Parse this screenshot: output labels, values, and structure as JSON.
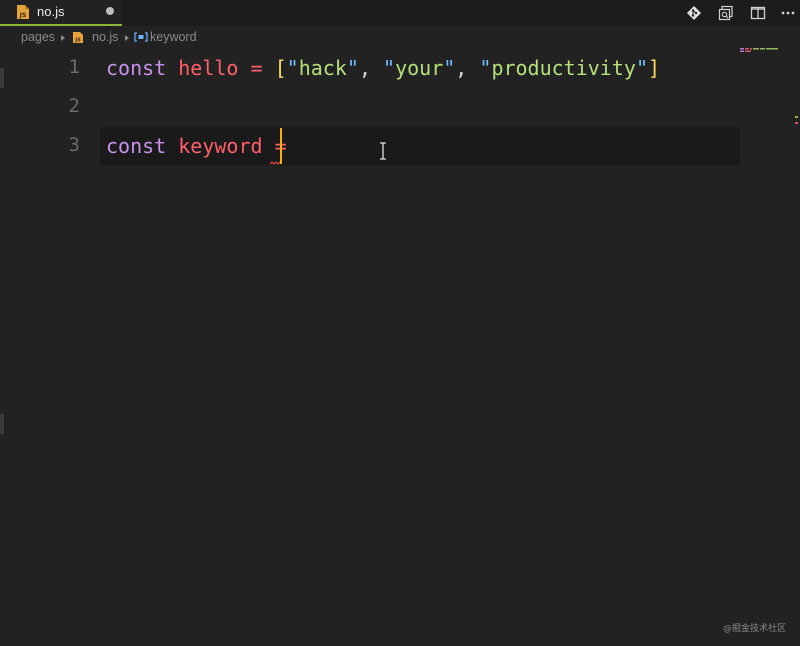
{
  "tab": {
    "filename": "no.js",
    "icon": "js-file-icon",
    "modified": true,
    "accent": "#8bb63a"
  },
  "actions": [
    {
      "name": "git-compare-icon"
    },
    {
      "name": "open-preview-icon"
    },
    {
      "name": "split-editor-icon"
    },
    {
      "name": "more-actions-icon"
    }
  ],
  "breadcrumb": {
    "folder": "pages",
    "file": "no.js",
    "symbol": "keyword"
  },
  "editor": {
    "line_numbers": [
      "1",
      "2",
      "3"
    ],
    "line1": {
      "kw": "const",
      "name": "hello",
      "eq": "=",
      "open": "[",
      "s1": "hack",
      "s2": "your",
      "s3": "productivity",
      "comma": ",",
      "quote": "\"",
      "close": "]"
    },
    "line3": {
      "kw": "const",
      "name": "keyword",
      "eq": "="
    },
    "colors": {
      "keyword": "#c792ea",
      "variable": "#ff5f6a",
      "string": "#b5e07a",
      "bracket": "#ffd866",
      "cursor": "#f4b400"
    }
  },
  "watermark": "@掘金技术社区"
}
